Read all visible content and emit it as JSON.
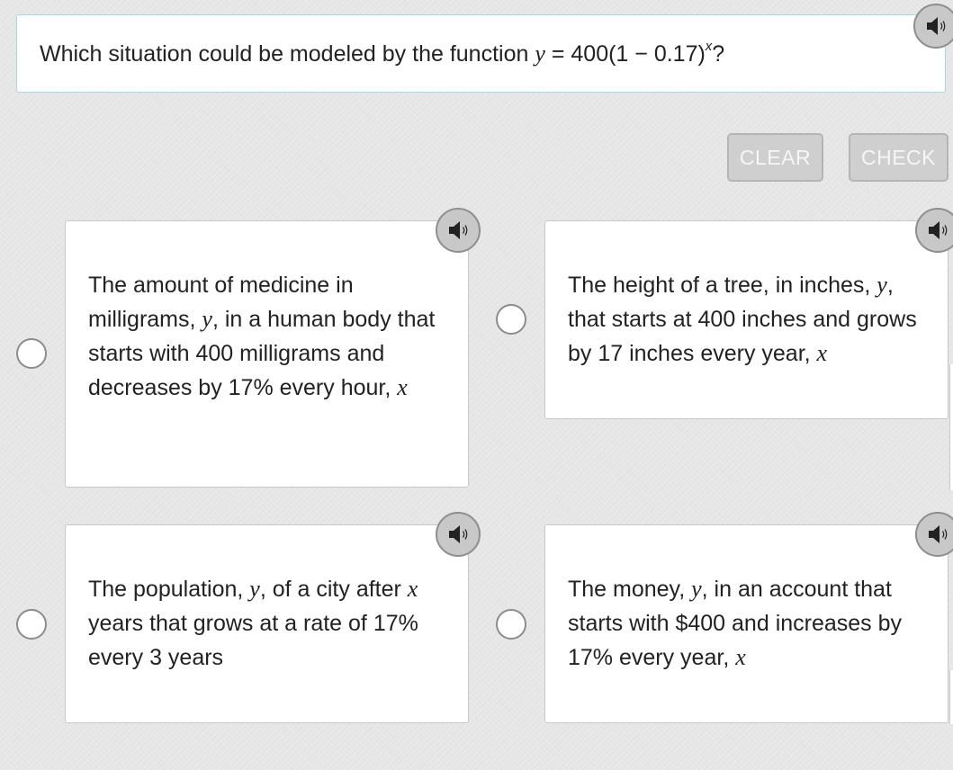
{
  "question": {
    "prefix": "Which situation could be modeled by the function ",
    "var_y": "y",
    "equals": " = 400(1 − 0.17)",
    "exponent": "x",
    "suffix": "?"
  },
  "buttons": {
    "clear": "CLEAR",
    "check": "CHECK"
  },
  "options": [
    {
      "parts": [
        "The amount of medicine in milligrams, ",
        "y",
        ", in a human body that starts with 400 milligrams and decreases by 17% every hour, ",
        "x",
        ""
      ]
    },
    {
      "parts": [
        "The height of a tree, in inches, ",
        "y",
        ", that starts at 400 inches and grows by 17 inches every year, ",
        "x",
        ""
      ]
    },
    {
      "parts": [
        "The population, ",
        "y",
        ", of a city after ",
        "x",
        " years that grows at a rate of 17% every 3 years"
      ]
    },
    {
      "parts": [
        "The money, ",
        "y",
        ", in an account that starts with $400 and increases by 17% every year, ",
        "x",
        ""
      ]
    }
  ],
  "icons": {
    "audio": "speaker-icon",
    "option_select": "radio-circle"
  },
  "colors": {
    "background": "#e6e6e6",
    "question_border": "#a8d6e3",
    "button_bg": "#cfcfcf",
    "audio_bg": "#c8c8c8"
  }
}
